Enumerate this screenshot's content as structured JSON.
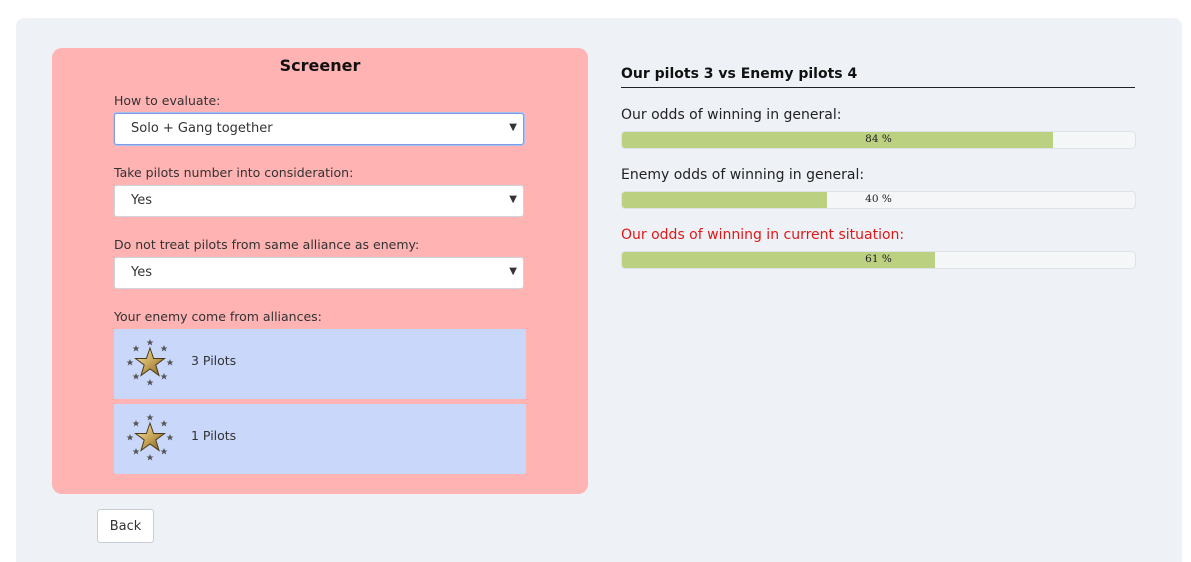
{
  "screener": {
    "title": "Screener",
    "evaluate": {
      "label": "How to evaluate:",
      "value": "Solo + Gang together"
    },
    "pilots_number": {
      "label": "Take pilots number into consideration:",
      "value": "Yes"
    },
    "same_alliance": {
      "label": "Do not treat pilots from same alliance as enemy:",
      "value": "Yes"
    },
    "alliances_label": "Your enemy come from alliances:",
    "alliances": [
      {
        "text": "3 Pilots",
        "icon": "star-emblem-icon"
      },
      {
        "text": "1 Pilots",
        "icon": "star-emblem-icon"
      }
    ]
  },
  "back_label": "Back",
  "results": {
    "matchup": "Our pilots 3 vs Enemy pilots 4",
    "odds": [
      {
        "label": "Our odds of winning in general:",
        "percent": 84,
        "text": "84 %"
      },
      {
        "label": "Enemy odds of winning in general:",
        "percent": 40,
        "text": "40 %"
      },
      {
        "label": "Our odds of winning in current situation:",
        "percent": 61,
        "text": "61 %",
        "highlight": true
      }
    ]
  },
  "colors": {
    "panel": "#ffb3b3",
    "card": "#c9d7fb",
    "bar_fill": "#bcd081",
    "alert": "#e01818"
  }
}
